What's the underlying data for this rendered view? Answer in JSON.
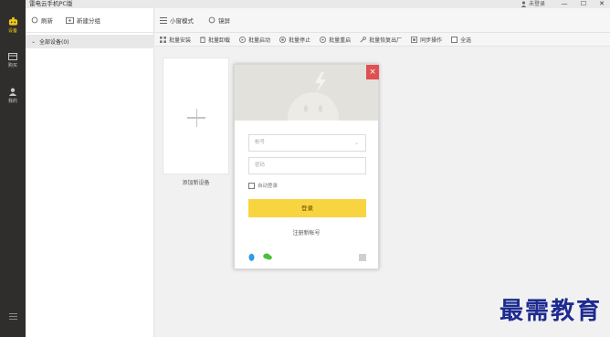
{
  "window": {
    "title": "雷电云手机PC版",
    "user_label": "未登录",
    "minimize": "—",
    "maximize": "☐",
    "close": "✕"
  },
  "sidebar": {
    "items": [
      {
        "label": "设备",
        "icon": "device-icon",
        "active": true
      },
      {
        "label": "购买",
        "icon": "cart-icon",
        "active": false
      },
      {
        "label": "我的",
        "icon": "user-icon",
        "active": false
      }
    ],
    "menu_icon": "menu-icon"
  },
  "group_panel": {
    "refresh": "刷新",
    "new_group": "新建分组",
    "all_devices": "全部设备(0)"
  },
  "toolbar": {
    "small_window": "小窗模式",
    "sync_screen": "镜屏"
  },
  "batch_toolbar": {
    "install": "批量安装",
    "uninstall": "批量卸载",
    "start": "批量启动",
    "stop": "批量停止",
    "restart": "批量重启",
    "restore": "批量恢复出厂",
    "sync": "同步操作",
    "select_all": "全选"
  },
  "add_device": {
    "label": "添加新设备"
  },
  "login": {
    "account_placeholder": "帐号",
    "password_placeholder": "密码",
    "remember": "自动登录",
    "submit": "登录",
    "register": "注册新帐号",
    "close": "×"
  },
  "watermark": "最需教育",
  "colors": {
    "accent": "#f9d441",
    "sidebar_bg": "#2f2e2c",
    "close_red": "#e05050",
    "watermark": "#1d2a8f"
  }
}
